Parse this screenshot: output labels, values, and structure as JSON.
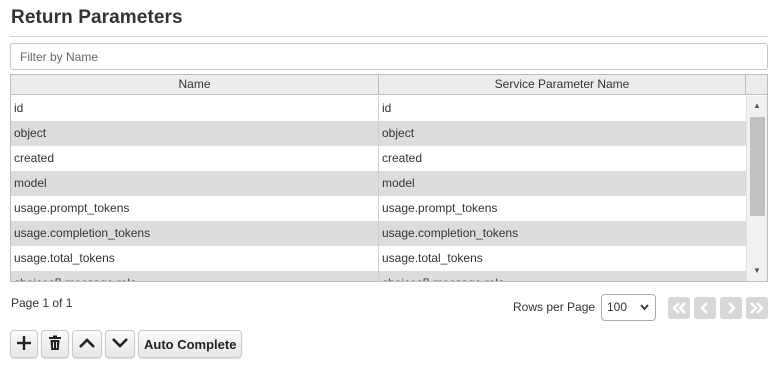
{
  "page": {
    "title": "Return Parameters"
  },
  "filter": {
    "placeholder": "Filter by Name",
    "value": ""
  },
  "grid": {
    "columns": [
      "Name",
      "Service Parameter Name"
    ],
    "rows": [
      [
        "id",
        "id"
      ],
      [
        "object",
        "object"
      ],
      [
        "created",
        "created"
      ],
      [
        "model",
        "model"
      ],
      [
        "usage.prompt_tokens",
        "usage.prompt_tokens"
      ],
      [
        "usage.completion_tokens",
        "usage.completion_tokens"
      ],
      [
        "usage.total_tokens",
        "usage.total_tokens"
      ],
      [
        "choices[].message.role",
        "choices[].message.role"
      ]
    ]
  },
  "pagination": {
    "page_info": "Page 1 of 1",
    "rows_per_page_label": "Rows per Page",
    "rows_per_page_value": "100"
  },
  "toolbar": {
    "auto_complete_label": "Auto Complete"
  },
  "colors": {
    "row_alt": "#dcdcdc",
    "header": "#ececec",
    "pager": "#d7d7d7"
  }
}
